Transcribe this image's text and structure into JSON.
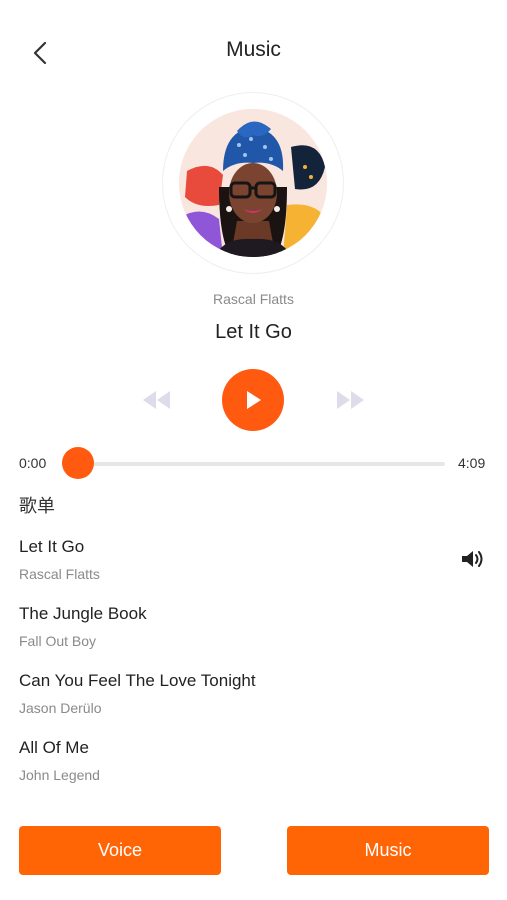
{
  "header": {
    "title": "Music",
    "back_icon": "chevron-left-icon"
  },
  "now_playing": {
    "artist": "Rascal Flatts",
    "title": "Let It Go",
    "art_icon": "album-art-portrait"
  },
  "controls": {
    "prev_icon": "rewind-icon",
    "play_icon": "play-icon",
    "next_icon": "fast-forward-icon"
  },
  "progress": {
    "current": "0:00",
    "total": "4:09",
    "fraction": 0
  },
  "playlist": {
    "heading": "歌单",
    "songs": [
      {
        "title": "Let It Go",
        "artist": "Rascal Flatts",
        "playing": true
      },
      {
        "title": "The Jungle Book",
        "artist": "Fall Out Boy",
        "playing": false
      },
      {
        "title": "Can You Feel The Love Tonight",
        "artist": "Jason Derülo",
        "playing": false
      },
      {
        "title": "All Of Me",
        "artist": "John Legend",
        "playing": false
      }
    ]
  },
  "footer": {
    "voice_label": "Voice",
    "music_label": "Music"
  },
  "colors": {
    "accent": "#ff5a10",
    "button": "#ff6505",
    "muted_text": "#8a8a8a",
    "disabled_icon": "#dcdde8"
  }
}
